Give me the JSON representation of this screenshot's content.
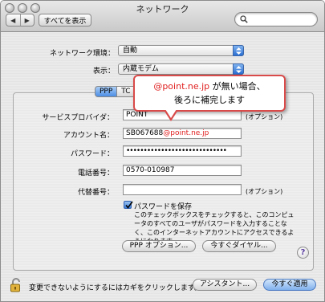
{
  "window": {
    "title": "ネットワーク"
  },
  "toolbar": {
    "back": "◀",
    "forward": "▶",
    "show_all": "すべてを表示",
    "search_placeholder": ""
  },
  "location": {
    "label": "ネットワーク環境：",
    "value": "自動"
  },
  "show": {
    "label": "表示：",
    "value": "内蔵モデム"
  },
  "tabs": {
    "active": "PPP",
    "second": "TC"
  },
  "form": {
    "provider_label": "サービスプロバイダ：",
    "provider_value": "POINT",
    "provider_hint": "(オプション)",
    "account_label": "アカウント名：",
    "account_value": "SB067688",
    "account_suffix": "@point.ne.jp",
    "password_label": "パスワード：",
    "password_value": "•••••••••••••••••••••••••••••",
    "phone_label": "電話番号：",
    "phone_value": "0570-010987",
    "alt_label": "代替番号：",
    "alt_value": "",
    "alt_hint": "(オプション)",
    "save_password_label": "パスワードを保存",
    "save_password_checked": true,
    "note": "このチェックボックスをチェックすると、このコンピュータのすべてのユーザがパスワードを入力することなく、このインターネットアカウントにアクセスできるようになります。"
  },
  "buttons": {
    "ppp_options": "PPP オプション...",
    "dial_now": "今すぐダイヤル...",
    "help": "?",
    "assistant": "アシスタント...",
    "apply_now": "今すぐ適用"
  },
  "footer": {
    "lock_text": "変更できないようにするにはカギをクリックします。"
  },
  "callout": {
    "line1": "@point.ne.jp が無い場合、",
    "line2": "後ろに補完します"
  },
  "colors": {
    "accent": "#4c8ee4",
    "callout_border": "#d94a4a",
    "highlight_text": "#e02020"
  }
}
